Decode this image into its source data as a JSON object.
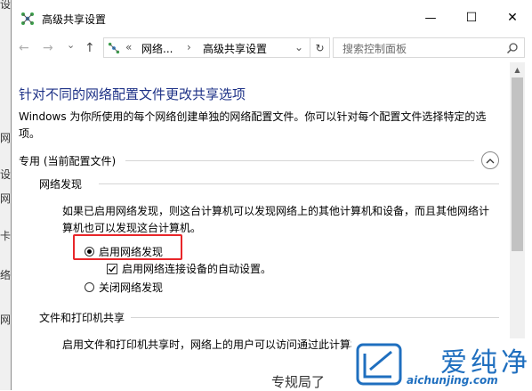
{
  "background": {
    "side_fragments": [
      "设",
      "网",
      "设",
      "网",
      "卡",
      "络",
      "网"
    ],
    "bottom_fragment": "专规局了"
  },
  "window": {
    "title": "高级共享设置",
    "controls": {
      "minimize": "—",
      "maximize": "☐",
      "close": "✕"
    }
  },
  "address_bar": {
    "back": "←",
    "forward": "→",
    "recent": "⌄",
    "up": "↑",
    "overflow": "«",
    "path": [
      "网络...",
      "高级共享设置"
    ],
    "separator": "›",
    "dropdown": "⌄",
    "refresh": "↻",
    "search_placeholder": "搜索控制面板"
  },
  "content": {
    "heading": "针对不同的网络配置文件更改共享选项",
    "description": "Windows 为你所使用的每个网络创建单独的网络配置文件。你可以针对每个配置文件选择特定的选项。",
    "profile_label": "专用 (当前配置文件)",
    "network_discovery": {
      "title": "网络发现",
      "description": "如果已启用网络发现，则这台计算机可以发现网络上的其他计算机和设备，而且其他网络计算机也可以发现这台计算机。",
      "option_on": "启用网络发现",
      "auto_setup": "启用网络连接设备的自动设置。",
      "option_off": "关闭网络发现",
      "selected": "on",
      "auto_setup_checked": true
    },
    "file_printer_sharing": {
      "title": "文件和打印机共享",
      "description_partial": "启用文件和打印机共享时，网络上的用户可以访问通过此计算机"
    }
  },
  "watermark": {
    "brand": "爱纯净",
    "url": "aichunjing.com",
    "color": "#1f6fbf"
  },
  "colors": {
    "heading": "#1e3287",
    "highlight": "#e8262a"
  }
}
